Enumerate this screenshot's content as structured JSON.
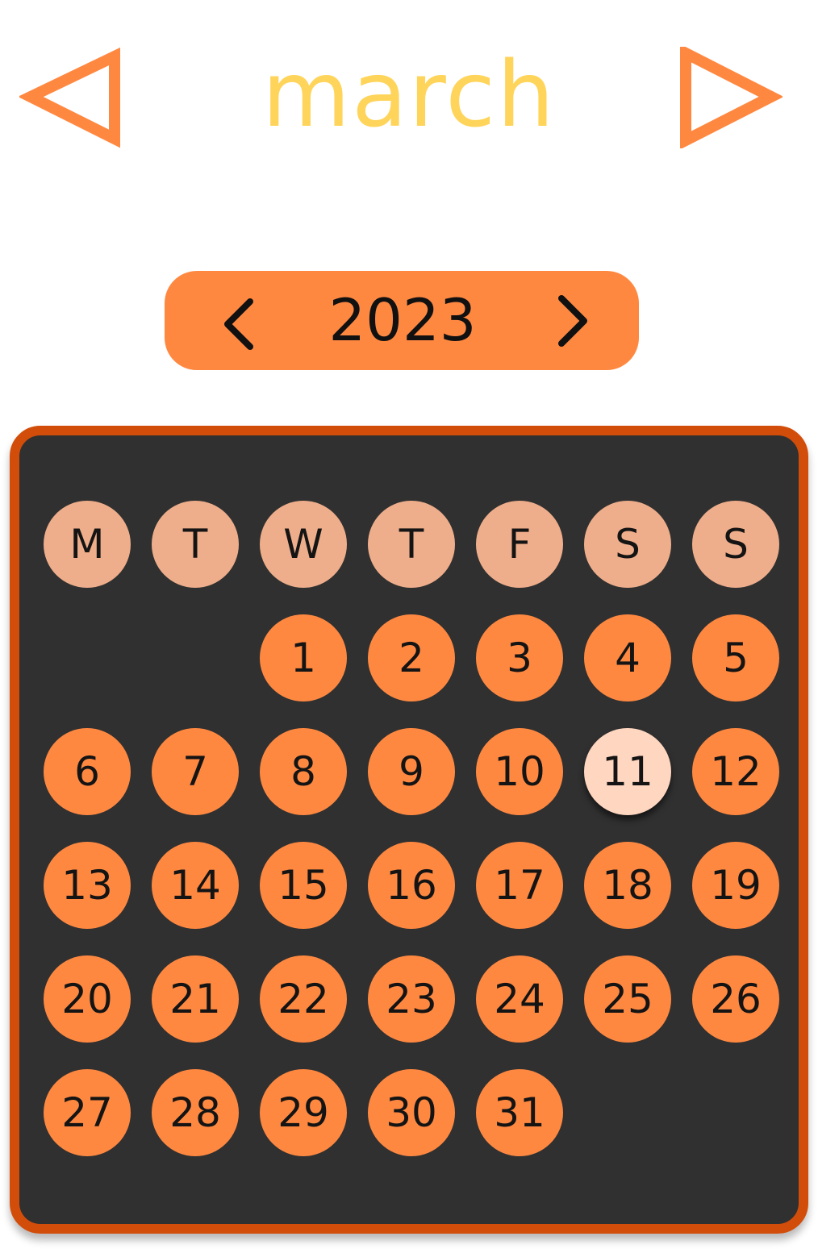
{
  "header": {
    "month": "march",
    "prev_icon": "triangle-left-icon",
    "next_icon": "triangle-right-icon"
  },
  "year_selector": {
    "year": "2023",
    "prev_icon": "chevron-left-icon",
    "next_icon": "chevron-right-icon"
  },
  "calendar": {
    "weekdays": [
      "M",
      "T",
      "W",
      "T",
      "F",
      "S",
      "S"
    ],
    "leading_blanks": 2,
    "days": [
      "1",
      "2",
      "3",
      "4",
      "5",
      "6",
      "7",
      "8",
      "9",
      "10",
      "11",
      "12",
      "13",
      "14",
      "15",
      "16",
      "17",
      "18",
      "19",
      "20",
      "21",
      "22",
      "23",
      "24",
      "25",
      "26",
      "27",
      "28",
      "29",
      "30",
      "31"
    ],
    "selected_day": "11"
  },
  "colors": {
    "month_title": "#ffd45a",
    "arrows": "#ff8841",
    "accent": "#ff8841",
    "panel_border": "#d24d0a",
    "panel_background": "#303030",
    "weekday_circle": "#efae8b",
    "selected_day": "#ffd6c0"
  }
}
